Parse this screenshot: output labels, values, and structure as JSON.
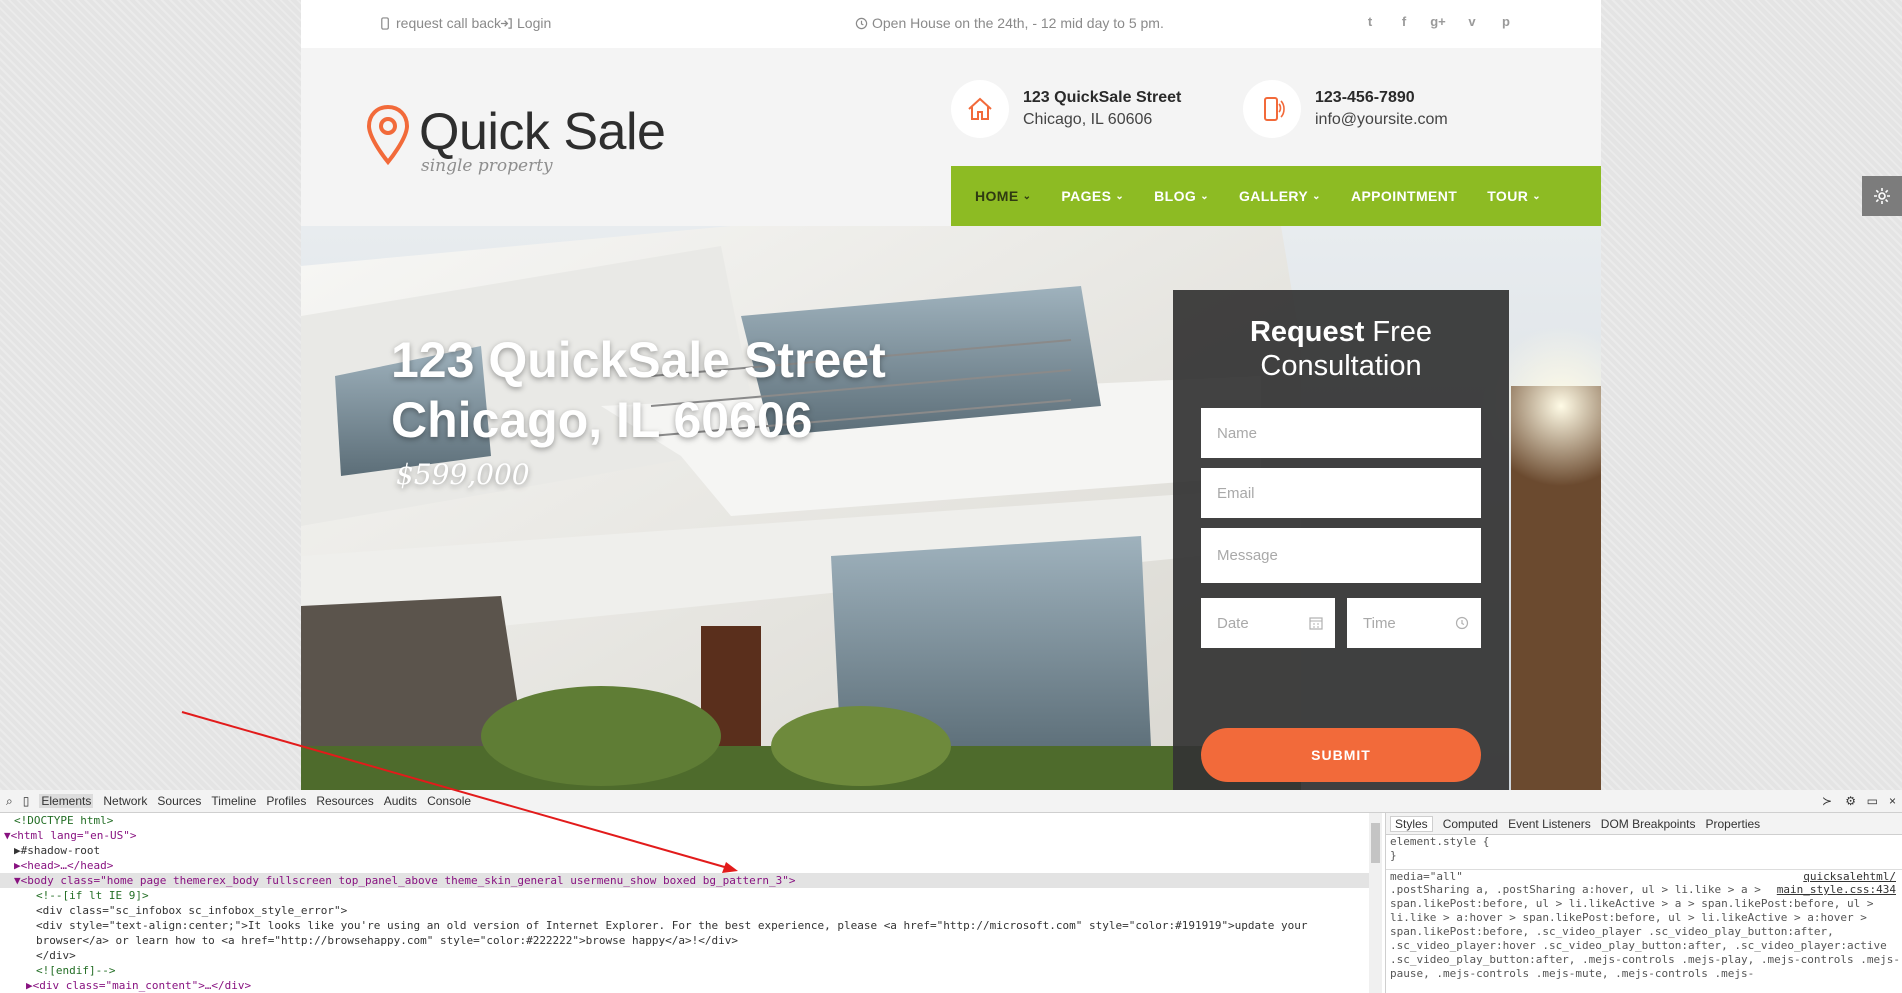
{
  "topbar": {
    "callback": "request call back",
    "login": "Login",
    "open_house": "Open House on the 24th, - 12 mid day to 5 pm."
  },
  "logo": {
    "title": "Quick Sale",
    "subtitle": "single property"
  },
  "contact": {
    "address_line1": "123 QuickSale Street",
    "address_line2": "Chicago, IL 60606",
    "phone": "123-456-7890",
    "email": "info@yoursite.com"
  },
  "nav": {
    "items": [
      {
        "label": "HOME",
        "has_dropdown": true,
        "active": true
      },
      {
        "label": "PAGES",
        "has_dropdown": true
      },
      {
        "label": "BLOG",
        "has_dropdown": true
      },
      {
        "label": "GALLERY",
        "has_dropdown": true
      },
      {
        "label": "APPOINTMENT",
        "has_dropdown": false
      },
      {
        "label": "TOUR",
        "has_dropdown": true
      }
    ]
  },
  "hero": {
    "title_line1": "123 QuickSale Street",
    "title_line2": "Chicago, IL 60606",
    "price": "$599,000"
  },
  "form": {
    "title_bold": "Request",
    "title_rest": "Free",
    "title_line2": "Consultation",
    "name_placeholder": "Name",
    "email_placeholder": "Email",
    "message_placeholder": "Message",
    "date_placeholder": "Date",
    "time_placeholder": "Time",
    "submit": "SUBMIT"
  },
  "devtools": {
    "tabs": [
      "Elements",
      "Network",
      "Sources",
      "Timeline",
      "Profiles",
      "Resources",
      "Audits",
      "Console"
    ],
    "styles_tabs": [
      "Styles",
      "Computed",
      "Event Listeners",
      "DOM Breakpoints",
      "Properties"
    ],
    "dom_lines": {
      "l1": "<!DOCTYPE html>",
      "l2_tag": "<html lang=\"en-US\">",
      "l3": "#shadow-root",
      "l4": "<head>…</head>",
      "l5": "<body class=\"home page themerex_body fullscreen top_panel_above theme_skin_general usermenu_show boxed bg_pattern_3\">",
      "l6": "<!--[if lt IE 9]>",
      "l7": "<div class=\"sc_infobox sc_infobox_style_error\">",
      "l8": "<div style=\"text-align:center;\">It looks like you're using an old version of Internet Explorer. For the best experience, please <a href=\"http://microsoft.com\" style=\"color:#191919\">update your",
      "l9": "browser</a> or learn how to <a href=\"http://browsehappy.com\" style=\"color:#222222\">browse happy</a>!</div>",
      "l10": "</div>",
      "l11": "<![endif]-->",
      "l12": "<div class=\"main_content\">…</div>"
    },
    "styles_lines": {
      "s1": "element.style {",
      "s2": "}",
      "s3": "media=\"all\"",
      "s3_link": "quicksalehtml/",
      "s4": ".postSharing a, .postSharing a:hover, ul > li.like > a >",
      "s4_link": "main_style.css:434",
      "s5": "span.likePost:before, ul > li.likeActive > a > span.likePost:before, ul >",
      "s6": "li.like > a:hover > span.likePost:before, ul > li.likeActive > a:hover >",
      "s7": "span.likePost:before, .sc_video_player .sc_video_play_button:after,",
      "s8": ".sc_video_player:hover .sc_video_play_button:after, .sc_video_player:active",
      "s9": ".sc_video_play_button:after, .mejs-controls .mejs-play, .mejs-controls .mejs-",
      "s10": "pause, .mejs-controls .mejs-mute, .mejs-controls .mejs-"
    }
  },
  "colors": {
    "accent_green": "#8dbb23",
    "accent_orange": "#f26a3a",
    "annotation_red": "#e21b1b"
  }
}
